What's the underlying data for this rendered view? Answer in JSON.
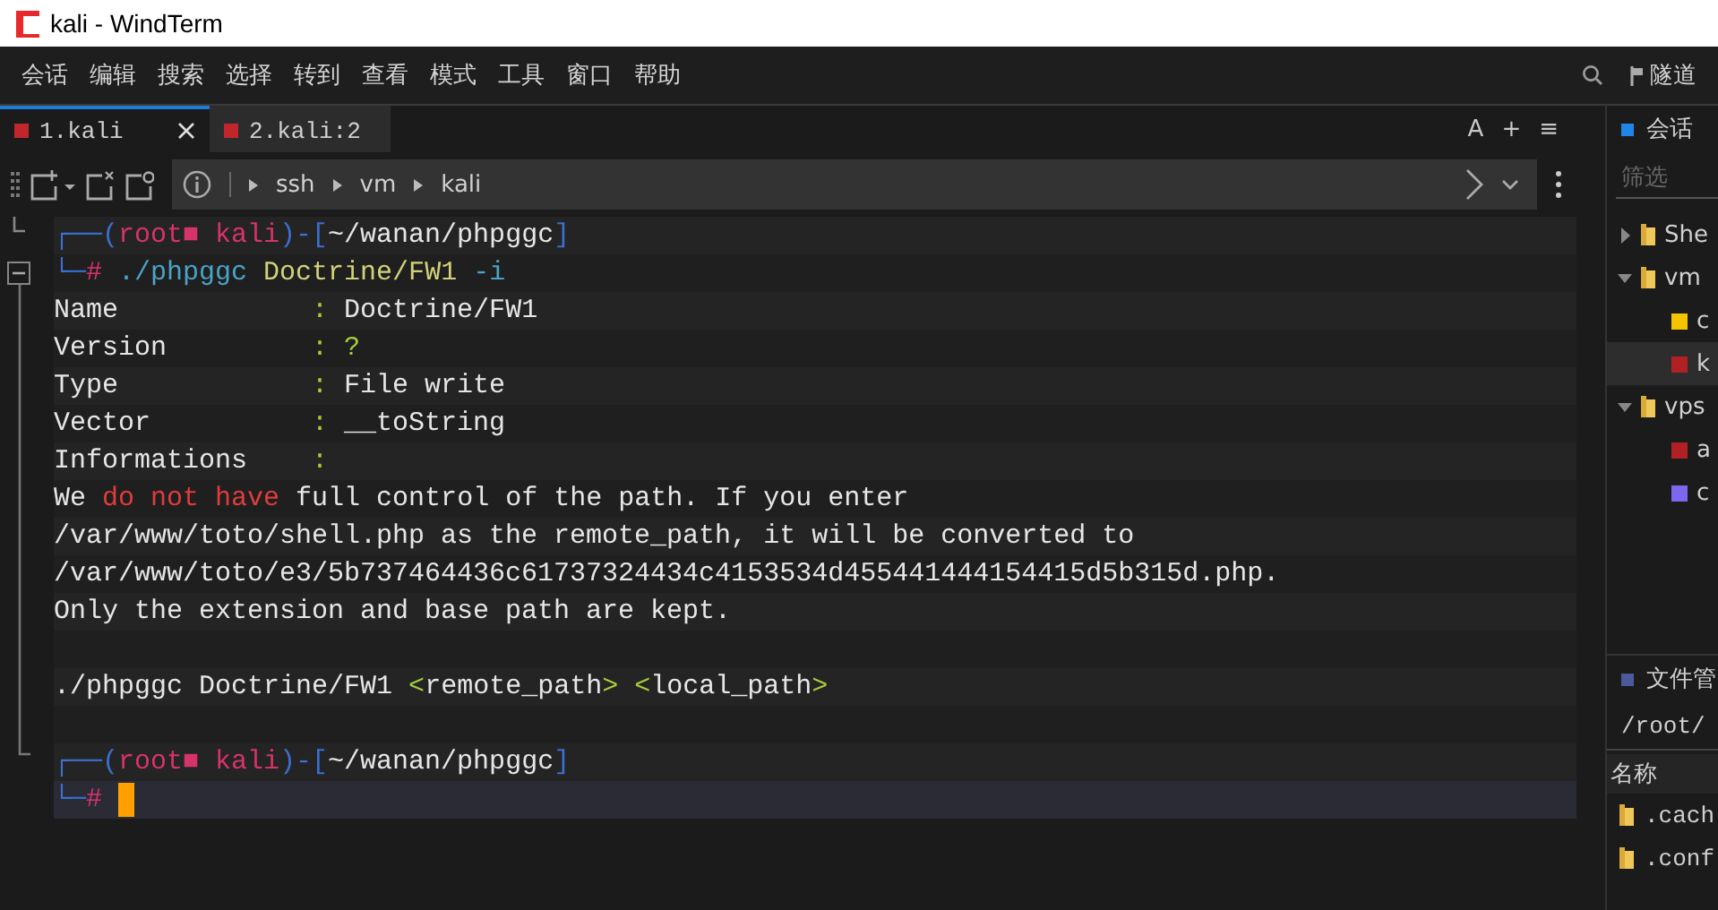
{
  "window": {
    "title": "kali - WindTerm"
  },
  "menu": [
    "会话",
    "编辑",
    "搜索",
    "选择",
    "转到",
    "查看",
    "模式",
    "工具",
    "窗口",
    "帮助"
  ],
  "tunnel": {
    "label": "隧道"
  },
  "tabs": [
    {
      "label": "1.kali",
      "selected": true,
      "color": "#c0262c"
    },
    {
      "label": "2.kali:2",
      "selected": false,
      "color": "#c0262c"
    }
  ],
  "tab_actions": [
    "A",
    "+",
    "≡"
  ],
  "breadcrumb": [
    "ssh",
    "vm",
    "kali"
  ],
  "terminal": {
    "lines": [
      {
        "kind": "text",
        "segments": [
          {
            "text": "┌──(",
            "color": "#3b6fd0"
          },
          {
            "text": "root■ kali",
            "color": "#d6336b"
          },
          {
            "text": ")-[",
            "color": "#3b6fd0"
          },
          {
            "text": "~/wanan/phpggc",
            "color": "#e6e6e6"
          },
          {
            "text": "]",
            "color": "#3b6fd0"
          }
        ]
      },
      {
        "kind": "text",
        "segments": [
          {
            "text": "└─",
            "color": "#3b6fd0"
          },
          {
            "text": "#",
            "color": "#d6336b"
          },
          {
            "text": " ./phpggc",
            "color": "#4ba3c7"
          },
          {
            "text": " Doctrine/FW1",
            "color": "#d2d27a"
          },
          {
            "text": " -i",
            "color": "#4ba3c7"
          }
        ]
      },
      {
        "kind": "text",
        "segments": [
          {
            "text": "Name            ",
            "color": "#e6e6e6"
          },
          {
            "text": ":",
            "color": "#a8cc3c"
          },
          {
            "text": " Doctrine/FW1",
            "color": "#e6e6e6"
          }
        ]
      },
      {
        "kind": "text",
        "segments": [
          {
            "text": "Version         ",
            "color": "#e6e6e6"
          },
          {
            "text": ": ?",
            "color": "#a8cc3c"
          }
        ]
      },
      {
        "kind": "text",
        "segments": [
          {
            "text": "Type            ",
            "color": "#e6e6e6"
          },
          {
            "text": ":",
            "color": "#a8cc3c"
          },
          {
            "text": " File write",
            "color": "#e6e6e6"
          }
        ]
      },
      {
        "kind": "text",
        "segments": [
          {
            "text": "Vector          ",
            "color": "#e6e6e6"
          },
          {
            "text": ":",
            "color": "#a8cc3c"
          },
          {
            "text": " __toString",
            "color": "#e6e6e6"
          }
        ]
      },
      {
        "kind": "text",
        "segments": [
          {
            "text": "Informations    ",
            "color": "#e6e6e6"
          },
          {
            "text": ":",
            "color": "#a8cc3c"
          }
        ]
      },
      {
        "kind": "text",
        "segments": [
          {
            "text": "We ",
            "color": "#e6e6e6"
          },
          {
            "text": "do not have",
            "color": "#e03c3c"
          },
          {
            "text": " full control of the path. If you enter",
            "color": "#e6e6e6"
          }
        ]
      },
      {
        "kind": "text",
        "segments": [
          {
            "text": "/var/www/toto/shell.php as the remote_path, it will be converted to",
            "color": "#e6e6e6"
          }
        ]
      },
      {
        "kind": "text",
        "segments": [
          {
            "text": "/var/www/toto/e3/5b737464436c61737324434c4153534d455441444154415d5b315d.php.",
            "color": "#e6e6e6"
          }
        ]
      },
      {
        "kind": "text",
        "segments": [
          {
            "text": "Only the extension and base path are kept.",
            "color": "#e6e6e6"
          }
        ]
      },
      {
        "kind": "blank"
      },
      {
        "kind": "text",
        "segments": [
          {
            "text": "./phpggc Doctrine/FW1 ",
            "color": "#e6e6e6"
          },
          {
            "text": "<",
            "color": "#a8cc3c"
          },
          {
            "text": "remote_path",
            "color": "#e6e6e6"
          },
          {
            "text": "> <",
            "color": "#a8cc3c"
          },
          {
            "text": "local_path",
            "color": "#e6e6e6"
          },
          {
            "text": ">",
            "color": "#a8cc3c"
          }
        ]
      },
      {
        "kind": "blank"
      },
      {
        "kind": "text",
        "segments": [
          {
            "text": "┌──(",
            "color": "#3b6fd0"
          },
          {
            "text": "root■ kali",
            "color": "#d6336b"
          },
          {
            "text": ")-[",
            "color": "#3b6fd0"
          },
          {
            "text": "~/wanan/phpggc",
            "color": "#e6e6e6"
          },
          {
            "text": "]",
            "color": "#3b6fd0"
          }
        ]
      },
      {
        "kind": "text",
        "segments": [
          {
            "text": "└─",
            "color": "#3b6fd0"
          },
          {
            "text": "#",
            "color": "#d6336b"
          }
        ],
        "current": true,
        "cursor": true
      }
    ]
  },
  "sessions": {
    "title": "会话",
    "filter_placeholder": "筛选",
    "tree": [
      {
        "label": "She",
        "kind": "folder",
        "expanded": false,
        "selected": false
      },
      {
        "label": "vm",
        "kind": "folder",
        "expanded": true,
        "selected": false,
        "children": [
          {
            "label": "c",
            "kind": "session",
            "color": "#f5c400",
            "selected": false
          },
          {
            "label": "k",
            "kind": "session",
            "color": "#b02025",
            "selected": true
          }
        ]
      },
      {
        "label": "vps",
        "kind": "folder",
        "expanded": true,
        "selected": false,
        "children": [
          {
            "label": "a",
            "kind": "session",
            "color": "#b02025",
            "selected": false
          },
          {
            "label": "c",
            "kind": "session",
            "color": "#7b68ee",
            "selected": false
          }
        ]
      }
    ]
  },
  "file_manager": {
    "title": "文件管",
    "path": "/root/",
    "column": "名称",
    "files": [
      ".cach",
      ".conf"
    ]
  }
}
